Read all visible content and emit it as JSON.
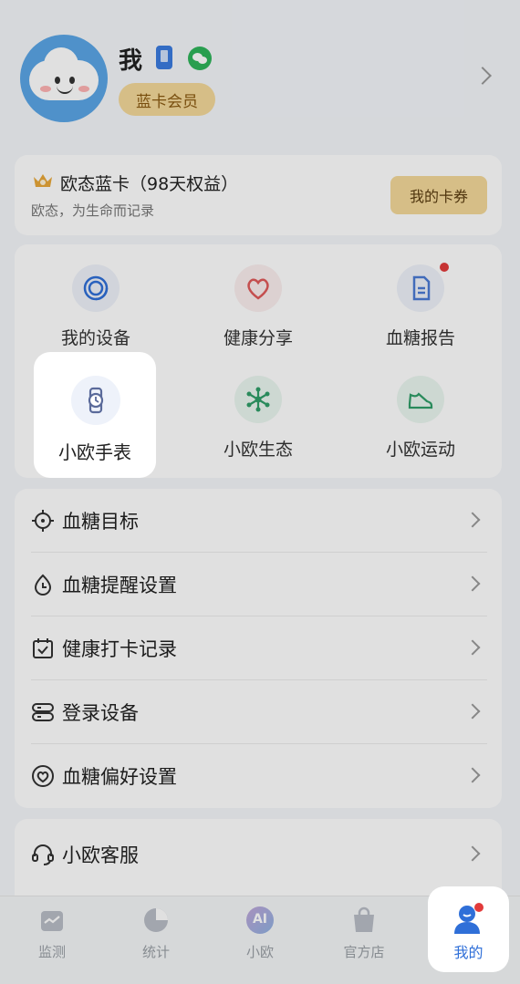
{
  "profile": {
    "name": "我",
    "member_badge": "蓝卡会员"
  },
  "membership": {
    "title": "欧态蓝卡（98天权益）",
    "subtitle": "欧态，为生命而记录",
    "coupon_button": "我的卡券"
  },
  "grid": {
    "items": [
      {
        "label": "我的设备",
        "icon": "device-icon"
      },
      {
        "label": "健康分享",
        "icon": "heart-share-icon"
      },
      {
        "label": "血糖报告",
        "icon": "report-icon",
        "badge": "red-dot"
      },
      {
        "label": "小欧手表",
        "icon": "watch-icon",
        "highlighted": true
      },
      {
        "label": "小欧生态",
        "icon": "ecosystem-icon"
      },
      {
        "label": "小欧运动",
        "icon": "sneaker-icon"
      }
    ]
  },
  "menu": {
    "items": [
      {
        "label": "血糖目标",
        "icon": "target-icon"
      },
      {
        "label": "血糖提醒设置",
        "icon": "drop-reminder-icon"
      },
      {
        "label": "健康打卡记录",
        "icon": "calendar-check-icon"
      },
      {
        "label": "登录设备",
        "icon": "server-icon"
      },
      {
        "label": "血糖偏好设置",
        "icon": "heart-settings-icon"
      }
    ]
  },
  "service": {
    "label": "小欧客服",
    "icon": "headset-icon"
  },
  "tabbar": {
    "tabs": [
      {
        "label": "监测",
        "icon": "monitor-icon"
      },
      {
        "label": "统计",
        "icon": "pie-chart-icon"
      },
      {
        "label": "小欧",
        "icon": "ai-icon",
        "icon_text": "AI"
      },
      {
        "label": "官方店",
        "icon": "shopping-bag-icon"
      },
      {
        "label": "我的",
        "icon": "profile-icon",
        "active": true
      }
    ]
  },
  "colors": {
    "accent": "#2f6fd8",
    "badge_gold": "#f4d99a",
    "red_dot": "#e23b3b"
  }
}
